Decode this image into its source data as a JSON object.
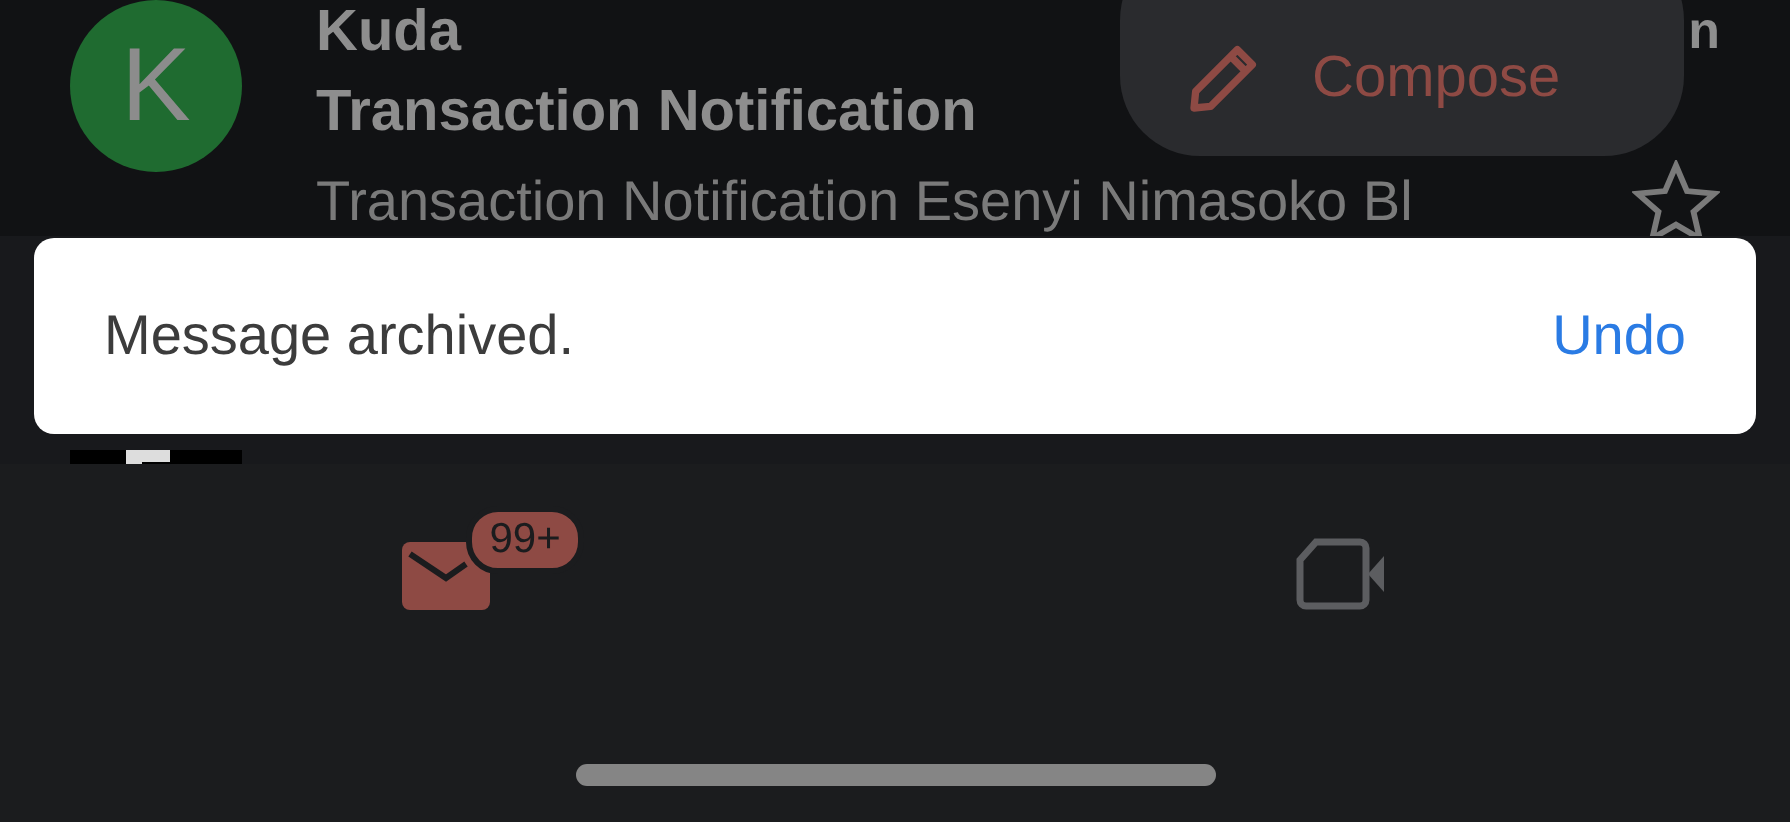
{
  "messages": [
    {
      "kind": "full",
      "avatar_letter": "K",
      "color": "#1f6b30",
      "sender": "Kuda",
      "time": "n",
      "subject": "Transaction Notification",
      "snippet": "Transaction Notification Esenyi Nimasoko Bl",
      "starred": false
    },
    {
      "kind": "hidden"
    }
  ],
  "compose": {
    "label": "Compose"
  },
  "snackbar": {
    "message": "Message archived.",
    "action": "Undo"
  },
  "bottom_nav": [
    {
      "kind": "mail",
      "badge": "99+",
      "selected": true
    },
    {
      "kind": "meet",
      "selected": false
    }
  ]
}
